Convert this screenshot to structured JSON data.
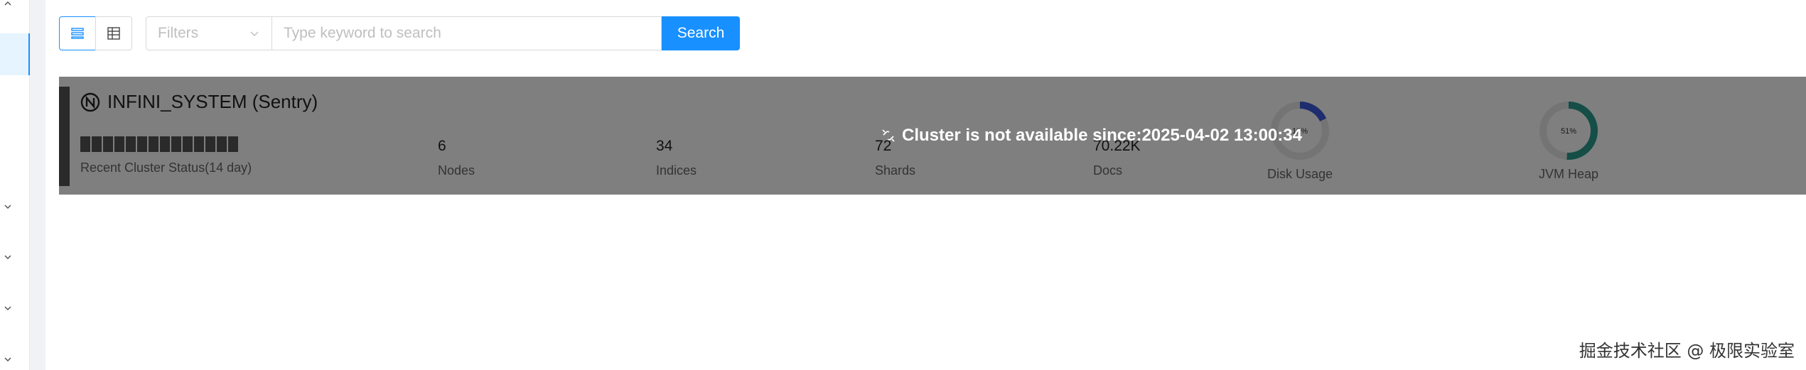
{
  "toolbar": {
    "filter_placeholder": "Filters",
    "search_placeholder": "Type keyword to search",
    "search_label": "Search",
    "view_modes": [
      "list-view-icon",
      "table-view-icon"
    ],
    "active_view": "list"
  },
  "cluster": {
    "name": "INFINI_SYSTEM (Sentry)",
    "status_label": "Recent Cluster Status(14 day)",
    "status_days": 14,
    "metrics": [
      {
        "value": "6",
        "label": "Nodes"
      },
      {
        "value": "34",
        "label": "Indices"
      },
      {
        "value": "72",
        "label": "Shards"
      },
      {
        "value": "70.22K",
        "label": "Docs"
      }
    ],
    "disk": {
      "label": "Disk Usage",
      "percent_text": "18%",
      "percent": 18,
      "color": "#3b5bdb"
    },
    "jvm": {
      "label": "JVM Heap",
      "percent_text": "51%",
      "percent": 51,
      "color": "#2a9d8f"
    },
    "unavailable_message": "Cluster is not available since:2025-04-02 13:00:34"
  },
  "watermark": "掘金技术社区 @ 极限实验室",
  "colors": {
    "accent": "#1890ff",
    "overlay": "rgba(0,0,0,0.5)"
  }
}
